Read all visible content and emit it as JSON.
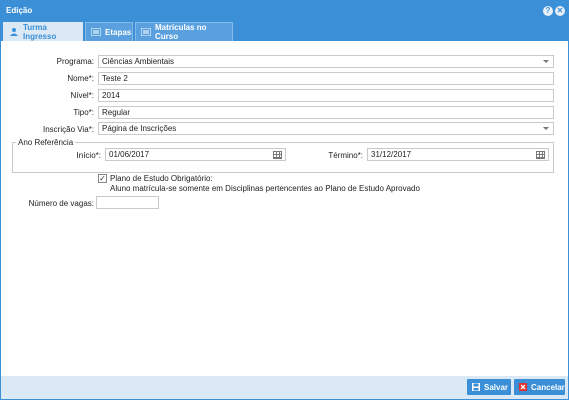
{
  "window": {
    "title": "Edição",
    "help_glyph": "?",
    "close_glyph": "✕"
  },
  "tabs": [
    {
      "label": "Turma Ingresso",
      "icon": "user-icon",
      "active": true
    },
    {
      "label": "Etapas",
      "icon": "list-icon",
      "active": false
    },
    {
      "label": "Matrículas no Curso",
      "icon": "list-icon",
      "active": false
    }
  ],
  "form": {
    "programa": {
      "label": "Programa:",
      "value": "Ciências Ambientais"
    },
    "nome": {
      "label": "Nome*:",
      "value": "Teste 2"
    },
    "nivel": {
      "label": "Nível*:",
      "value": "2014"
    },
    "tipo": {
      "label": "Tipo*:",
      "value": "Regular"
    },
    "inscricao_via": {
      "label": "Inscrição Via*:",
      "value": "Página de Inscrições"
    },
    "ano_referencia": {
      "legend": "Ano Referência",
      "inicio": {
        "label": "Início*:",
        "value": "01/06/2017"
      },
      "termino": {
        "label": "Término*:",
        "value": "31/12/2017"
      }
    },
    "plano": {
      "checked": true,
      "check_glyph": "✓",
      "label": "Plano de Estudo Obrigatório:",
      "help": "Aluno matrícula-se somente em Disciplinas pertencentes ao Plano de Estudo Aprovado"
    },
    "vagas": {
      "label": "Número de vagas:",
      "value": ""
    }
  },
  "footer": {
    "save_label": "Salvar",
    "cancel_label": "Cancelar"
  },
  "colors": {
    "accent": "#3a8fd6",
    "tab_active_bg": "#dbe9f6",
    "cancel_icon": "#e0302a"
  }
}
